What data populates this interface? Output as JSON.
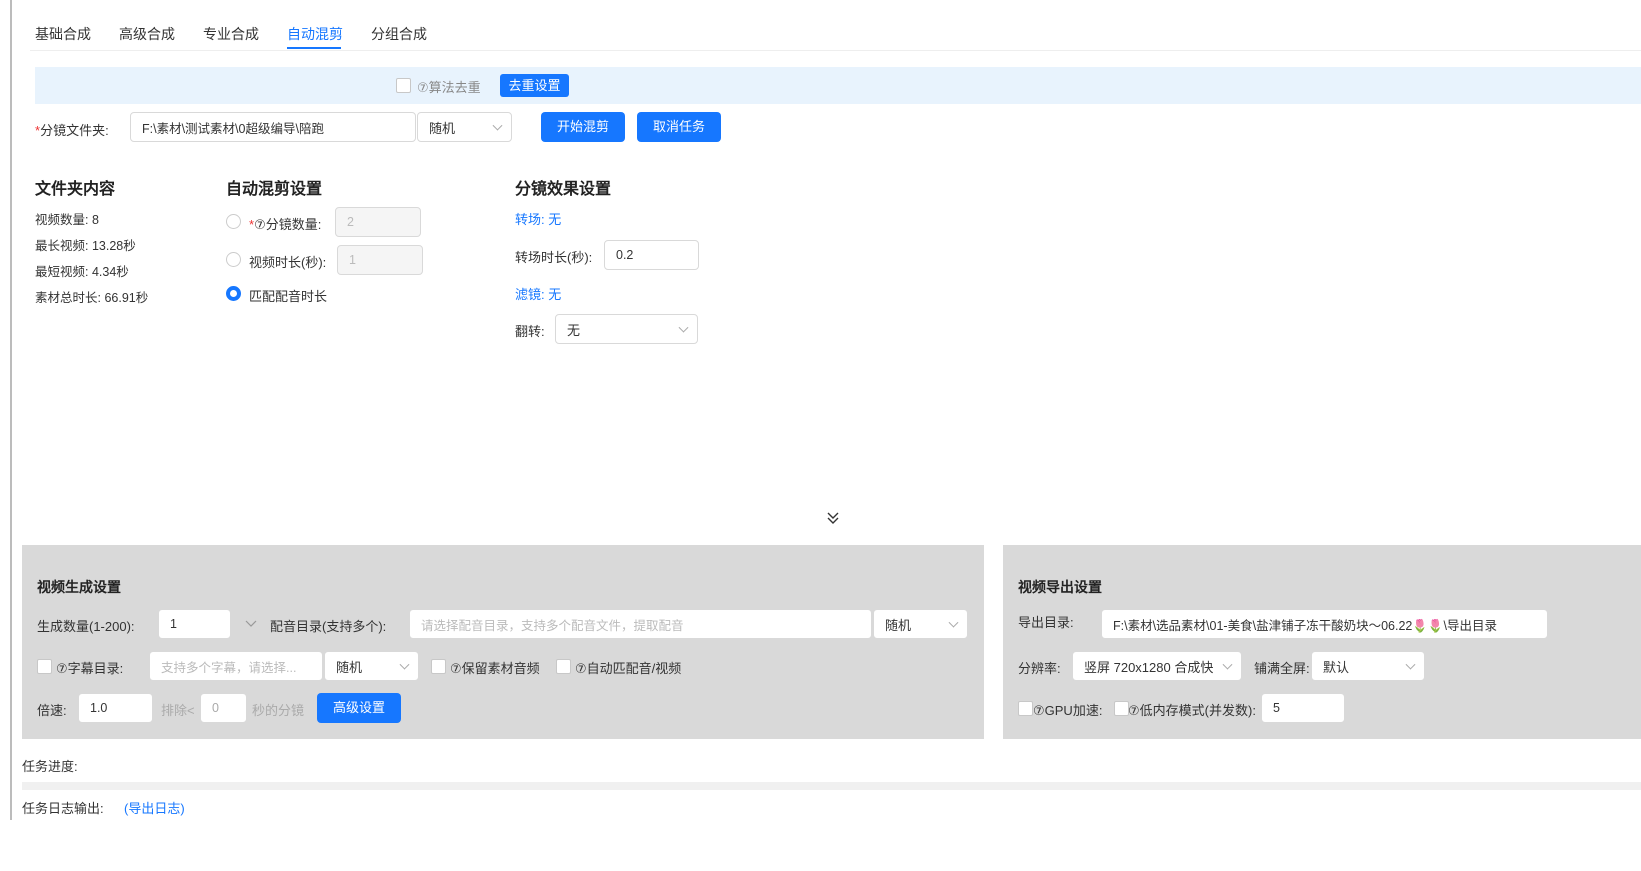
{
  "tabs": [
    {
      "label": "基础合成"
    },
    {
      "label": "高级合成"
    },
    {
      "label": "专业合成"
    },
    {
      "label": "自动混剪"
    },
    {
      "label": "分组合成"
    }
  ],
  "active_tab": "自动混剪",
  "dedup": {
    "checkbox_label": "⑦算法去重",
    "button": "去重设置"
  },
  "folder_row": {
    "required_mark": "*",
    "label": "分镜文件夹:",
    "path": "F:\\素材\\测试素材\\0超级编导\\陪跑",
    "order": "随机",
    "start_button": "开始混剪",
    "cancel_button": "取消任务"
  },
  "folder_content": {
    "title": "文件夹内容",
    "video_count": "视频数量: 8",
    "longest": "最长视频: 13.28秒",
    "shortest": "最短视频: 4.34秒",
    "total": "素材总时长: 66.91秒"
  },
  "auto_mix": {
    "title": "自动混剪设置",
    "opt1_req": "*",
    "opt1_label": "⑦分镜数量:",
    "opt1_value": "2",
    "opt2_label": "视频时长(秒):",
    "opt2_value": "1",
    "opt3_label": "匹配配音时长",
    "selected": 3
  },
  "effects": {
    "title": "分镜效果设置",
    "transition": "转场: 无",
    "transition_duration_label": "转场时长(秒):",
    "transition_duration_value": "0.2",
    "filter": "滤镜: 无",
    "flip_label": "翻转:",
    "flip_value": "无"
  },
  "expand_icon": "double-chevron-down",
  "video_gen": {
    "title": "视频生成设置",
    "count_label": "生成数量(1-200):",
    "count_value": "1",
    "audio_dir_label": "配音目录(支持多个):",
    "audio_dir_placeholder": "请选择配音目录，支持多个配音文件，提取配音",
    "audio_order": "随机",
    "subtitle_label": "⑦字幕目录:",
    "subtitle_placeholder": "支持多个字幕，请选择...",
    "subtitle_order": "随机",
    "keep_audio_label": "⑦保留素材音频",
    "auto_match_label": "⑦自动匹配音/视频",
    "speed_label": "倍速:",
    "speed_value": "1.0",
    "exclude_label": "排除<",
    "exclude_value": "0",
    "exclude_suffix": "秒的分镜",
    "advanced_button": "高级设置"
  },
  "video_export": {
    "title": "视频导出设置",
    "dir_label": "导出目录:",
    "dir_value": "F:\\素材\\选品素材\\01-美食\\盐津铺子冻干酸奶块～06.22🌷🌷\\导出目录",
    "resolution_label": "分辨率:",
    "resolution_value": "竖屏 720x1280 合成快",
    "fill_label": "铺满全屏:",
    "fill_value": "默认",
    "gpu_label": "⑦GPU加速:",
    "lowmem_label": "⑦低内存模式(并发数):",
    "lowmem_value": "5"
  },
  "task": {
    "progress_label": "任务进度:",
    "progress": 0,
    "log_label": "任务日志输出:",
    "export_log": "(导出日志)"
  },
  "colors": {
    "accent": "#1677ff",
    "panel": "#d9d9d9",
    "bluebar": "#e8f3fd"
  }
}
